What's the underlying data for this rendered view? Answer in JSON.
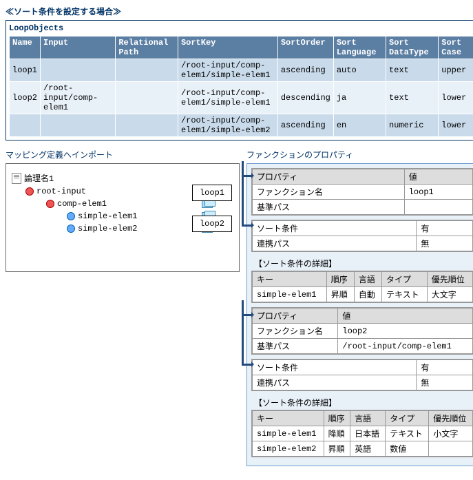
{
  "title": "≪ソート条件を設定する場合≫",
  "loopObjects": {
    "title": "LoopObjects",
    "headers": {
      "name": "Name",
      "input": "Input",
      "path": "Relational\nPath",
      "key": "SortKey",
      "order": "SortOrder",
      "lang": "Sort\nLanguage",
      "dtype": "Sort\nDataType",
      "case": "Sort\nCase"
    },
    "rows": [
      {
        "name": "loop1",
        "input": "",
        "path": "",
        "key": "/root-input/comp-elem1/simple-elem1",
        "order": "ascending",
        "lang": "auto",
        "dtype": "text",
        "case": "upper"
      },
      {
        "name": "loop2",
        "input": "/root-input/comp-elem1",
        "path": "",
        "key": "/root-input/comp-elem1/simple-elem1",
        "order": "descending",
        "lang": "ja",
        "dtype": "text",
        "case": "lower"
      },
      {
        "name": "",
        "input": "",
        "path": "",
        "key": "/root-input/comp-elem1/simple-elem2",
        "order": "ascending",
        "lang": "en",
        "dtype": "numeric",
        "case": "lower"
      }
    ]
  },
  "mapping": {
    "title": "マッピング定義へインポート",
    "tree": {
      "root": "論理名1",
      "l1": "root-input",
      "l2": "comp-elem1",
      "l3a": "simple-elem1",
      "l3b": "simple-elem2"
    },
    "loop1": "loop1",
    "loop2": "loop2"
  },
  "func": {
    "title": "ファンクションのプロパティ",
    "headers": {
      "prop": "プロパティ",
      "val": "値",
      "fname": "ファンクション名",
      "basepath": "基準パス",
      "sortcond": "ソート条件",
      "linkpath": "連携パス",
      "detail": "【ソート条件の詳細】",
      "key": "キー",
      "order": "順序",
      "lang": "言語",
      "type": "タイプ",
      "prio": "優先順位"
    },
    "group1": {
      "fname": "loop1",
      "basepath": "",
      "sortcond": "有",
      "linkpath": "無",
      "details": [
        {
          "key": "simple-elem1",
          "order": "昇順",
          "lang": "自動",
          "type": "テキスト",
          "prio": "大文字"
        }
      ]
    },
    "group2": {
      "fname": "loop2",
      "basepath": "/root-input/comp-elem1",
      "sortcond": "有",
      "linkpath": "無",
      "details": [
        {
          "key": "simple-elem1",
          "order": "降順",
          "lang": "日本語",
          "type": "テキスト",
          "prio": "小文字"
        },
        {
          "key": "simple-elem2",
          "order": "昇順",
          "lang": "英語",
          "type": "数値",
          "prio": ""
        }
      ]
    }
  }
}
